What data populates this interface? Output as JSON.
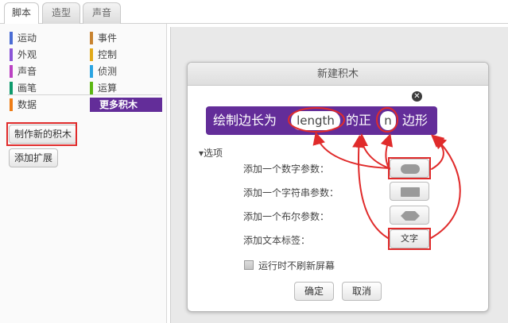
{
  "tabs": [
    "脚本",
    "造型",
    "声音"
  ],
  "categories": {
    "left": [
      {
        "label": "运动",
        "color": "#4a6cd4"
      },
      {
        "label": "外观",
        "color": "#8a55d7"
      },
      {
        "label": "声音",
        "color": "#bb42c3"
      },
      {
        "label": "画笔",
        "color": "#0e9a6c"
      },
      {
        "label": "数据",
        "color": "#ee7d16"
      }
    ],
    "right": [
      {
        "label": "事件",
        "color": "#c88330"
      },
      {
        "label": "控制",
        "color": "#e1a91a"
      },
      {
        "label": "侦测",
        "color": "#2ca5e2"
      },
      {
        "label": "运算",
        "color": "#5cb712"
      },
      {
        "label": "更多积木",
        "color": "#632d99"
      }
    ]
  },
  "buttons": {
    "make_block": "制作新的积木",
    "add_extension": "添加扩展"
  },
  "dialog": {
    "title": "新建积木",
    "block": {
      "part1": "绘制边长为",
      "param1": "length",
      "part2": "的正",
      "param2": "n",
      "part3": "边形",
      "color": "#632d99"
    },
    "options_label": "选项",
    "options": [
      {
        "label": "添加一个数字参数：",
        "icon": "oval-shape-icon"
      },
      {
        "label": "添加一个字符串参数：",
        "icon": "rect-shape-icon"
      },
      {
        "label": "添加一个布尔参数：",
        "icon": "hexagon-shape-icon"
      },
      {
        "label": "添加文本标签：",
        "button_text": "文字"
      }
    ],
    "checkbox_label": "运行时不刷新屏幕",
    "ok": "确定",
    "cancel": "取消"
  },
  "annotation_color": "#e02b2b"
}
